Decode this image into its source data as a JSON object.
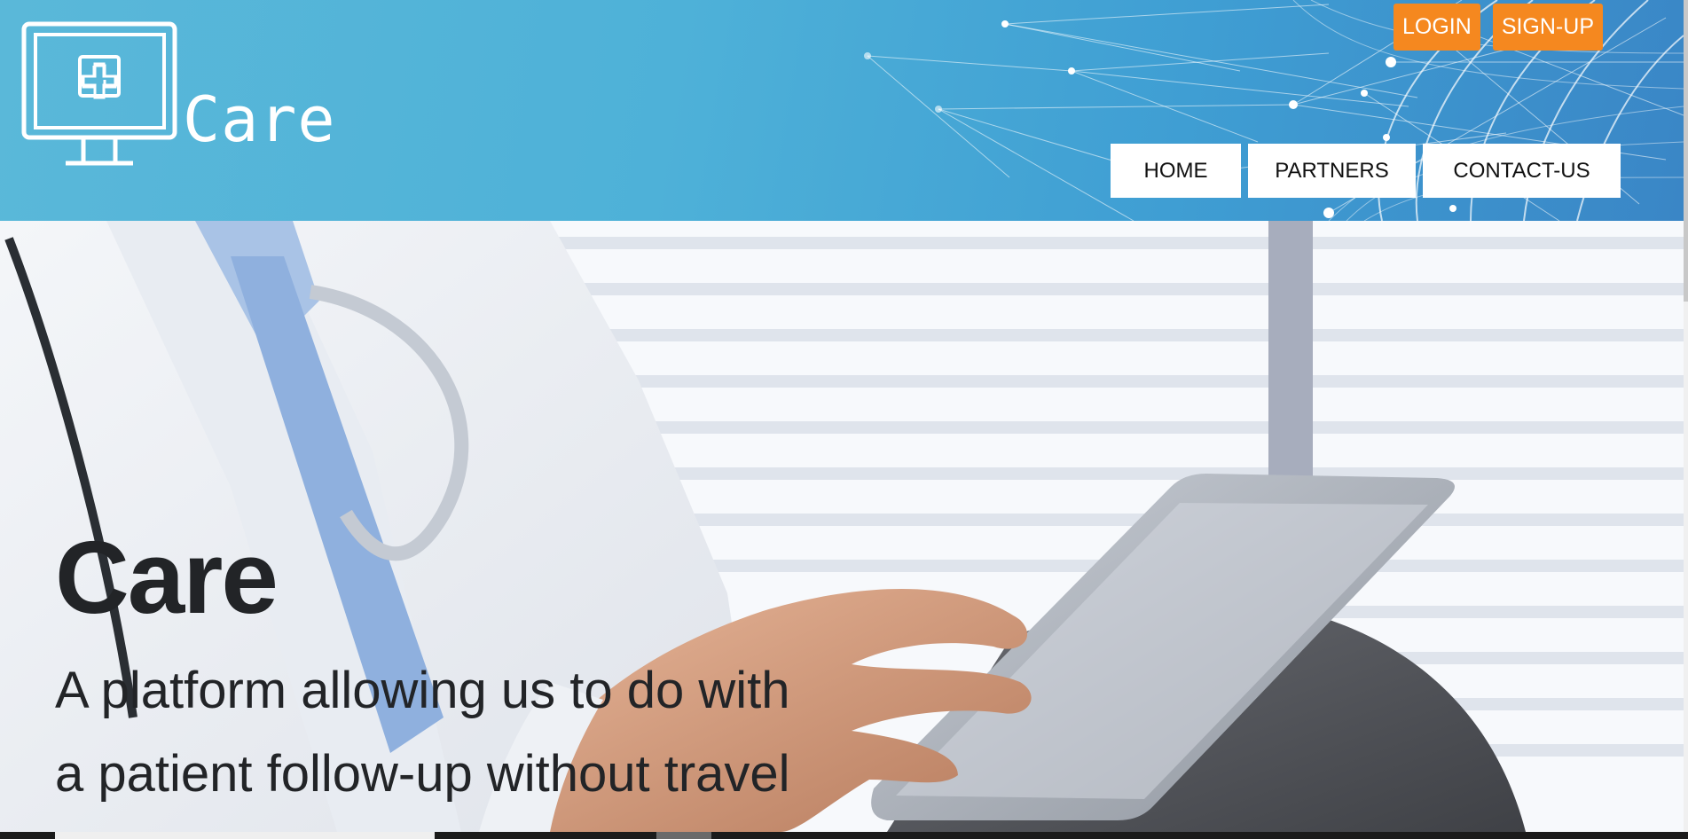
{
  "header": {
    "brand_name": "Care",
    "auth": {
      "login_label": "LOGIN",
      "signup_label": "SIGN-UP"
    },
    "nav": {
      "home": "HOME",
      "partners": "PARTNERS",
      "contact": "CONTACT-US"
    }
  },
  "hero": {
    "title": "Care",
    "subtitle": "A platform allowing us to do with a patient follow-up without travel"
  },
  "icons": {
    "logo": "monitor-medical-cross-icon"
  },
  "colors": {
    "header_bg": "#4eb1d8",
    "accent_button": "#f5881f",
    "nav_button_bg": "#ffffff",
    "hero_text": "#222427"
  }
}
